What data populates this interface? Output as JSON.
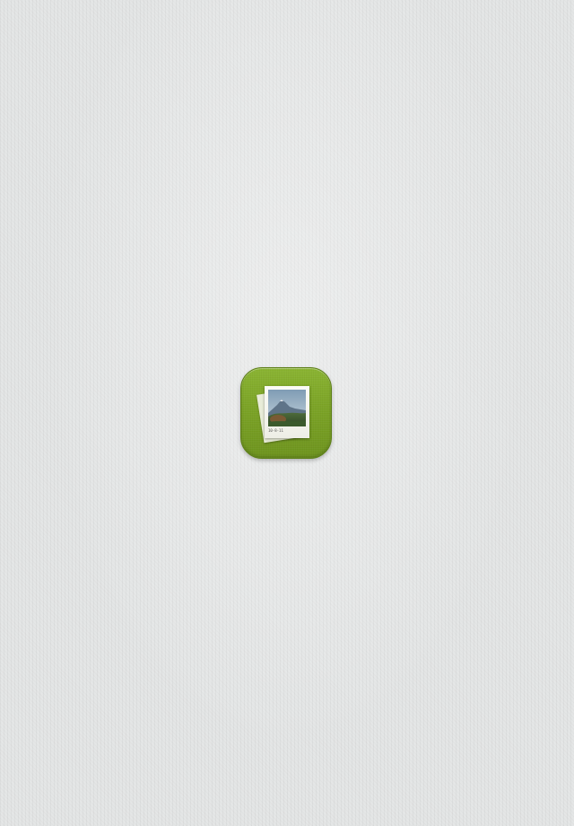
{
  "screen": {
    "background_color": "#e4e6e6"
  },
  "app_icon": {
    "icon_name": "photo-gallery-icon",
    "tile_color": "#7ca425",
    "photo_caption": "10-8-11"
  }
}
